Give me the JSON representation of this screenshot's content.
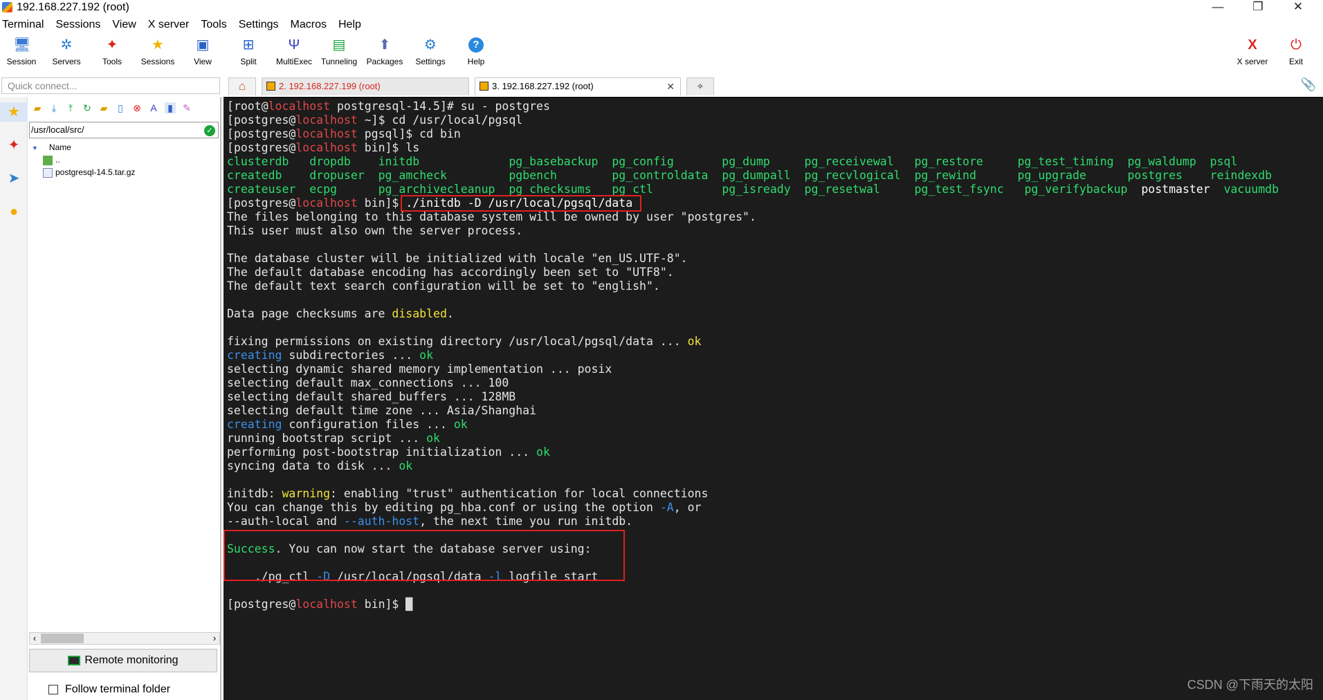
{
  "window": {
    "title": "192.168.227.192 (root)",
    "minimize": "—",
    "maximize": "❐",
    "close": "✕"
  },
  "menu": [
    "Terminal",
    "Sessions",
    "View",
    "X server",
    "Tools",
    "Settings",
    "Macros",
    "Help"
  ],
  "toolbar": {
    "left": [
      {
        "label": "Session",
        "icon": "session-icon"
      },
      {
        "label": "Servers",
        "icon": "servers-icon"
      },
      {
        "label": "Tools",
        "icon": "tools-icon"
      },
      {
        "label": "Sessions",
        "icon": "sessions-star-icon"
      },
      {
        "label": "View",
        "icon": "view-icon"
      },
      {
        "label": "Split",
        "icon": "split-icon"
      },
      {
        "label": "MultiExec",
        "icon": "multiexec-icon"
      },
      {
        "label": "Tunneling",
        "icon": "tunneling-icon"
      },
      {
        "label": "Packages",
        "icon": "packages-icon"
      },
      {
        "label": "Settings",
        "icon": "settings-icon"
      },
      {
        "label": "Help",
        "icon": "help-icon"
      }
    ],
    "right": [
      {
        "label": "X server",
        "icon": "xserver-icon"
      },
      {
        "label": "Exit",
        "icon": "exit-power-icon"
      }
    ]
  },
  "quick_connect": {
    "placeholder": "Quick connect..."
  },
  "sftp": {
    "path": "/usr/local/src/",
    "header": "Name",
    "files": [
      {
        "name": "..",
        "type": "parent-folder"
      },
      {
        "name": "postgresql-14.5.tar.gz",
        "type": "file"
      }
    ],
    "remote_monitoring": "Remote monitoring",
    "follow_terminal_folder": "Follow terminal folder",
    "scroll_left": "‹",
    "scroll_right": "›"
  },
  "tabs": {
    "home_icon": "⌂",
    "items": [
      {
        "label": "2. 192.168.227.199 (root)",
        "active": false,
        "color": "#d9261c"
      },
      {
        "label": "3. 192.168.227.192 (root)",
        "active": true,
        "color": "#000000"
      }
    ],
    "close_symbol": "✕",
    "new_tab": "✧"
  },
  "terminal": {
    "user": "postgres",
    "root_user": "root",
    "host": "localhost",
    "cmd_su": "su - postgres",
    "cmd_cd": "cd /usr/local/pgsql",
    "cmd_cdbin": "cd bin",
    "cmd_ls": "ls",
    "cmd_initdb": "./initdb -D /usr/local/pgsql/data",
    "ls_rows": [
      [
        "clusterdb",
        "dropdb",
        "initdb",
        "pg_basebackup",
        "pg_config",
        "pg_dump",
        "pg_receivewal",
        "pg_restore",
        "pg_test_timing",
        "pg_waldump",
        "psql"
      ],
      [
        "createdb",
        "dropuser",
        "pg_amcheck",
        "pgbench",
        "pg_controldata",
        "pg_dumpall",
        "pg_recvlogical",
        "pg_rewind",
        "pg_upgrade",
        "postgres",
        "reindexdb"
      ],
      [
        "createuser",
        "ecpg",
        "pg_archivecleanup",
        "pg_checksums",
        "pg_ctl",
        "pg_isready",
        "pg_resetwal",
        "pg_test_fsync",
        "pg_verifybackup",
        "postmaster",
        "vacuumdb"
      ]
    ],
    "out1": "The files belonging to this database system will be owned by user \"postgres\".",
    "out2": "This user must also own the server process.",
    "out3": "The database cluster will be initialized with locale \"en_US.UTF-8\".",
    "out4": "The default database encoding has accordingly been set to \"UTF8\".",
    "out5": "The default text search configuration will be set to \"english\".",
    "out6a": "Data page checksums are ",
    "out6b": "disabled",
    "out7": "fixing permissions on existing directory /usr/local/pgsql/data ... ",
    "ok": "ok",
    "creating": "creating",
    "out8": " subdirectories ... ",
    "out9": "selecting dynamic shared memory implementation ... posix",
    "out10": "selecting default max_connections ... 100",
    "out11": "selecting default shared_buffers ... 128MB",
    "out12": "selecting default time zone ... Asia/Shanghai",
    "out13": " configuration files ... ",
    "out14": "running bootstrap script ... ",
    "out15": "performing post-bootstrap initialization ... ",
    "out16": "syncing data to disk ... ",
    "warn_prefix": "initdb: ",
    "warning": "warning",
    "warn_text": ": enabling \"trust\" authentication for local connections",
    "warn2": "You can change this by editing pg_hba.conf or using the option ",
    "opt_A": "-A",
    "warn2b": ", or",
    "auth_local": "--auth-local",
    "and": " and ",
    "auth_host": "--auth-host",
    "warn3b": ", the next time you run initdb.",
    "success": "Success",
    "success_rest": ". You can now start the database server using:",
    "pgctl_a": "./pg_ctl ",
    "opt_D": "-D",
    "pgctl_b": " /usr/local/pgsql/data ",
    "opt_l": "-l",
    "pgctl_c": " logfile start"
  },
  "watermark": "CSDN @下雨天的太阳"
}
